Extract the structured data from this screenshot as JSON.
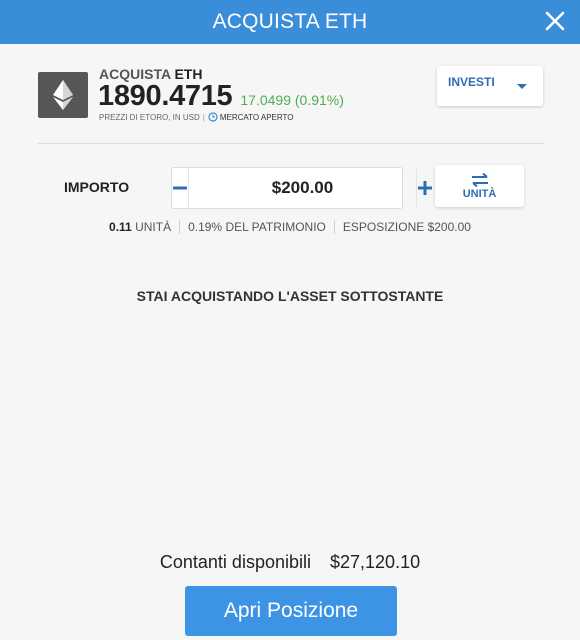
{
  "header": {
    "title": "ACQUISTA ETH",
    "close_icon": "close-icon"
  },
  "instrument": {
    "action": "ACQUISTA",
    "symbol": "ETH",
    "logo_icon": "ethereum-icon",
    "price": "1890.4715",
    "change": "17.0499 (0.91%)",
    "price_source": "PREZZI DI ETORO, IN USD",
    "market_status": "MERCATO APERTO",
    "change_color": "#4caf50"
  },
  "invest_dropdown": {
    "label": "INVESTI",
    "icon": "chevron-down-icon"
  },
  "amount": {
    "label": "IMPORTO",
    "value": "$200.00",
    "minus_icon": "minus-icon",
    "plus_icon": "plus-icon"
  },
  "units_toggle": {
    "label": "UNITÀ",
    "icon": "swap-arrows-icon"
  },
  "stats": {
    "units_value": "0.11",
    "units_label": "UNITÀ",
    "equity": "0.19% DEL PATRIMONIO",
    "exposure": "ESPOSIZIONE $200.00"
  },
  "notice": "STAI ACQUISTANDO L'ASSET SOTTOSTANTE",
  "cash": {
    "label": "Contanti disponibili",
    "value": "$27,120.10"
  },
  "open_button": {
    "label": "Apri Posizione"
  },
  "colors": {
    "accent": "#3a8dd9",
    "button": "#3e94e4",
    "link_blue": "#2f6db2"
  }
}
